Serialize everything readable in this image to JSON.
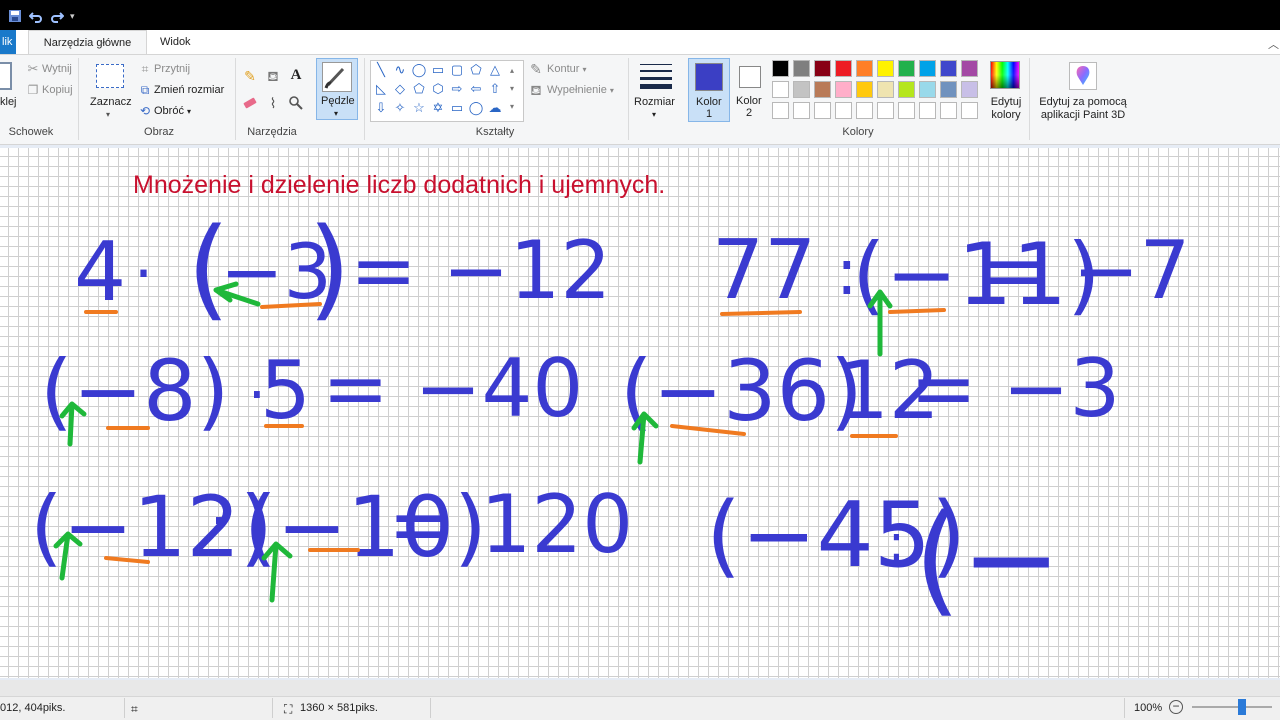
{
  "tabs": {
    "file": "lik",
    "home": "Narzędzia główne",
    "view": "Widok"
  },
  "ribbon": {
    "clipboard": {
      "paste": "klej",
      "cut": "Wytnij",
      "copy": "Kopiuj",
      "label": "Schowek"
    },
    "image": {
      "select": "Zaznacz",
      "crop": "Przytnij",
      "resize": "Zmień rozmiar",
      "rotate": "Obróć",
      "label": "Obraz"
    },
    "tools": {
      "label": "Narzędzia",
      "text_tool": "A"
    },
    "brushes": {
      "label": "Pędzle"
    },
    "shapes": {
      "label": "Kształty",
      "outline": "Kontur",
      "fill": "Wypełnienie"
    },
    "size": {
      "label": "Rozmiar"
    },
    "colors": {
      "color1_line1": "Kolor",
      "color1_line2": "1",
      "color2_line1": "Kolor",
      "color2_line2": "2",
      "edit_line1": "Edytuj",
      "edit_line2": "kolory",
      "label": "Kolory",
      "color1": "#3b3fc4",
      "color2": "#ffffff",
      "palette_row1": [
        "#000000",
        "#7f7f7f",
        "#880015",
        "#ed1c24",
        "#ff7f27",
        "#fff200",
        "#22b14c",
        "#00a2e8",
        "#3f48cc",
        "#a349a4"
      ],
      "palette_row2": [
        "#ffffff",
        "#c3c3c3",
        "#b97a57",
        "#ffaec9",
        "#ffc90e",
        "#efe4b0",
        "#b5e61d",
        "#99d9ea",
        "#7092be",
        "#c8bfe7"
      ]
    },
    "paint3d": {
      "line1": "Edytuj za pomocą",
      "line2": "aplikacji Paint 3D"
    }
  },
  "canvas": {
    "title": "Mnożenie i dzielenie liczb dodatnich i ujemnych.",
    "ink_blue": "#3a3ad0",
    "ink_orange": "#f07a20",
    "ink_green": "#1fb83a",
    "handwriting": {
      "e1_a": "4",
      "e1_b": "·",
      "e1_c": "(",
      "e1_d": "−3",
      "e1_e": ")",
      "e1_f": "= −12",
      "e2_a": "77",
      "e2_b": ":",
      "e2_c": "(−11)",
      "e2_d": "= −7",
      "e3_a": "(−8)",
      "e3_b": "·",
      "e3_c": "5",
      "e3_d": "= −40",
      "e4_a": "(−36)",
      "e4_b": ":",
      "e4_c": "12",
      "e4_d": "= −3",
      "e5_a": "(−12)",
      "e5_b": "·",
      "e5_c": "(−10)",
      "e5_d": "= 120",
      "e6_a": "(−45)",
      "e6_b": ":",
      "e6_c": "(−"
    }
  },
  "status": {
    "cursor": "012, 404piks.",
    "dimensions": "1360 × 581piks.",
    "zoom": "100%",
    "zoom_level": 0.62
  }
}
